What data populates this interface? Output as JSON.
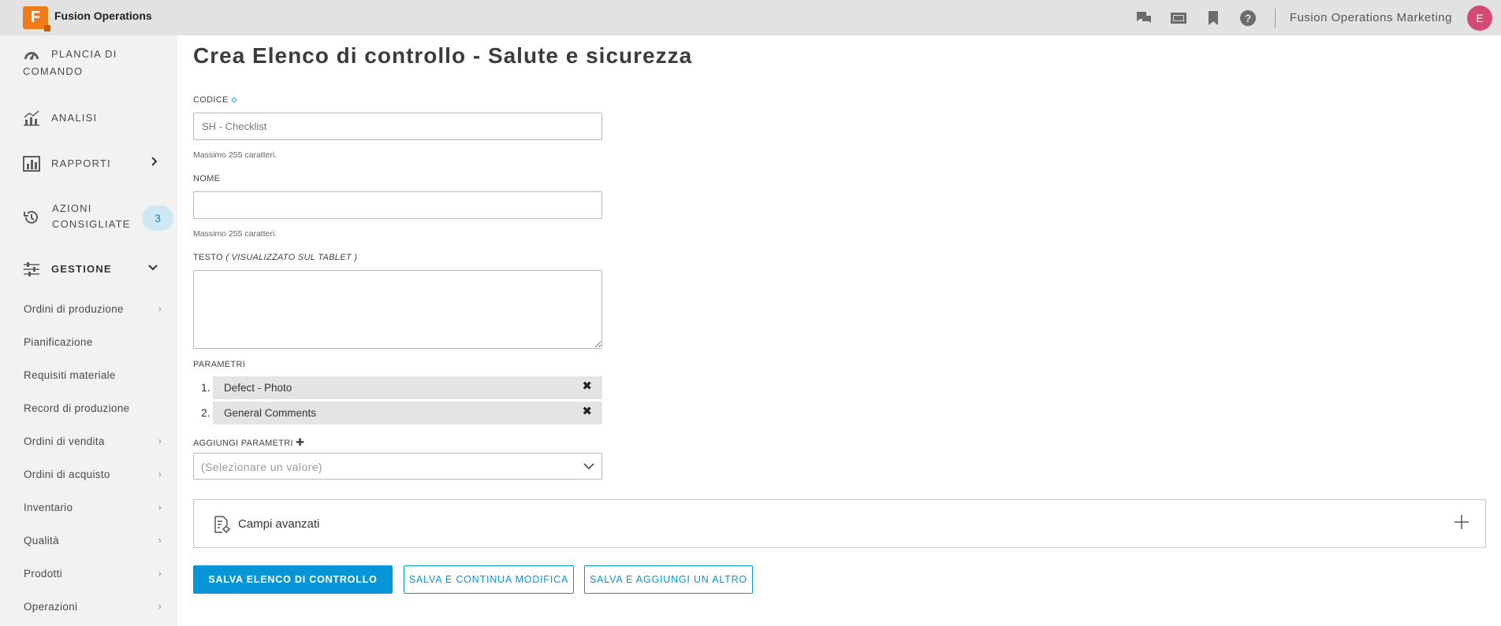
{
  "app": {
    "logo_letter": "F",
    "name": "Fusion Operations",
    "org_name": "Fusion Operations Marketing",
    "avatar_initial": "E"
  },
  "topbar": {
    "icons": [
      "chat-icon",
      "film-icon",
      "bookmark-icon",
      "help-icon"
    ]
  },
  "sidebar": {
    "main_items": [
      {
        "label_line1": "PLANCIA DI",
        "label_line2": "COMANDO",
        "icon": "dashboard-icon"
      },
      {
        "label": "ANALISI",
        "icon": "analytics-icon"
      },
      {
        "label": "RAPPORTI",
        "icon": "reports-icon"
      },
      {
        "label_line1": "AZIONI",
        "label_line2": "CONSIGLIATE",
        "icon": "history-icon",
        "badge": "3"
      },
      {
        "label": "GESTIONE",
        "icon": "sliders-icon"
      }
    ],
    "sub_items": [
      {
        "label": "Ordini di produzione",
        "has_chevron": true
      },
      {
        "label": "Pianificazione",
        "has_chevron": false
      },
      {
        "label": "Requisiti materiale",
        "has_chevron": false
      },
      {
        "label": "Record di produzione",
        "has_chevron": false
      },
      {
        "label": "Ordini di vendita",
        "has_chevron": true
      },
      {
        "label": "Ordini di acquisto",
        "has_chevron": true
      },
      {
        "label": "Inventario",
        "has_chevron": true
      },
      {
        "label": "Qualità",
        "has_chevron": true
      },
      {
        "label": "Prodotti",
        "has_chevron": true
      },
      {
        "label": "Operazioni",
        "has_chevron": true
      }
    ]
  },
  "form": {
    "title": "Crea Elenco di controllo - Salute e sicurezza",
    "codice": {
      "label": "CODICE",
      "placeholder": "SH - Checklist",
      "value": "",
      "hint": "Massimo 255 caratteri."
    },
    "nome": {
      "label": "NOME",
      "value": "",
      "hint": "Massimo 255 caratteri."
    },
    "testo": {
      "label_prefix": "TESTO",
      "label_suffix": "( VISUALIZZATO SUL TABLET )",
      "value": ""
    },
    "parametri": {
      "label": "PARAMETRI",
      "items": [
        {
          "num": "1.",
          "name": "Defect - Photo"
        },
        {
          "num": "2.",
          "name": "General Comments"
        }
      ]
    },
    "aggiungi": {
      "label": "AGGIUNGI PARAMETRI",
      "placeholder": "(Selezionare un valore)"
    },
    "advanced": {
      "label": "Campi avanzati"
    },
    "buttons": {
      "save": "SALVA ELENCO DI CONTROLLO",
      "save_continue": "SALVA E CONTINUA MODIFICA",
      "save_add": "SALVA E AGGIUNGI UN ALTRO"
    }
  },
  "colors": {
    "accent": "#0696d7",
    "logo": "#f07b1a",
    "avatar": "#d34b75",
    "badge_bg": "#cfe7f3"
  }
}
